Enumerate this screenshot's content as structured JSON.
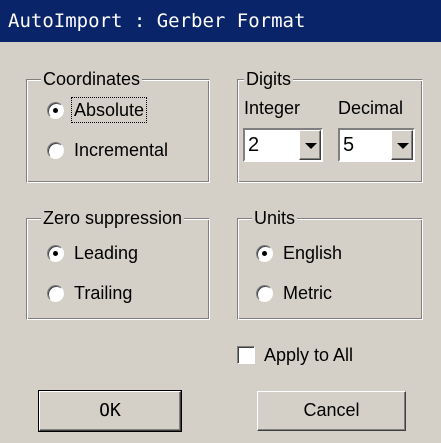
{
  "window": {
    "title": "AutoImport : Gerber Format"
  },
  "coordinates": {
    "legend": "Coordinates",
    "options": [
      {
        "label": "Absolute",
        "checked": true
      },
      {
        "label": "Incremental",
        "checked": false
      }
    ]
  },
  "digits": {
    "legend": "Digits",
    "integer_label": "Integer",
    "decimal_label": "Decimal",
    "integer_value": "2",
    "decimal_value": "5"
  },
  "zero_suppression": {
    "legend": "Zero suppression",
    "options": [
      {
        "label": "Leading",
        "checked": true
      },
      {
        "label": "Trailing",
        "checked": false
      }
    ]
  },
  "units": {
    "legend": "Units",
    "options": [
      {
        "label": "English",
        "checked": true
      },
      {
        "label": "Metric",
        "checked": false
      }
    ]
  },
  "apply_all": {
    "label": "Apply to All",
    "checked": false
  },
  "buttons": {
    "ok_label": "OK",
    "cancel_label": "Cancel"
  },
  "colors": {
    "titlebar": "#0a246a",
    "dialog_face": "#d4d0c8"
  }
}
